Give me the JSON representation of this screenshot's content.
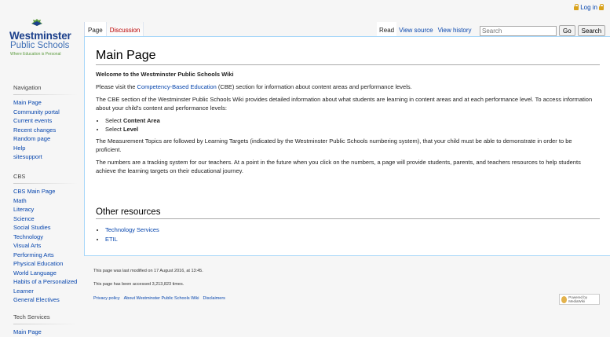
{
  "personal": {
    "login": "Log in"
  },
  "logo": {
    "line1": "Westminster",
    "line2": "Public Schools",
    "tagline": "Where Education is Personal"
  },
  "tabs": {
    "left": [
      "Page",
      "Discussion"
    ],
    "right": [
      "Read",
      "View source",
      "View history"
    ]
  },
  "search": {
    "placeholder": "Search",
    "go": "Go",
    "search": "Search"
  },
  "sidebar": {
    "navigation": {
      "heading": "Navigation",
      "items": [
        "Main Page",
        "Community portal",
        "Current events",
        "Recent changes",
        "Random page",
        "Help",
        "sitesupport"
      ]
    },
    "cbs": {
      "heading": "CBS",
      "items": [
        "CBS Main Page",
        "Math",
        "Literacy",
        "Science",
        "Social Studies",
        "Technology",
        "Visual Arts",
        "Performing Arts",
        "Physical Education",
        "World Language",
        "Habits of a Personalized Learner",
        "General Electives"
      ]
    },
    "tech": {
      "heading": "Tech Services",
      "items": [
        "Main Page"
      ]
    }
  },
  "content": {
    "title": "Main Page",
    "welcome": "Welcome to the Westminster Public Schools Wiki",
    "p1_before": "Please visit the ",
    "p1_link": "Competency-Based Education",
    "p1_after": " (CBE) section for information about content areas and performance levels.",
    "p2": "The CBE section of the Westminster Public Schools Wiki provides detailed information about what students are learning in content areas and at each performance level. To access information about your child's content and performance levels:",
    "bullets": [
      {
        "prefix": "Select ",
        "bold": "Content Area"
      },
      {
        "prefix": "Select ",
        "bold": "Level"
      }
    ],
    "p3": "The Measurement Topics are followed by Learning Targets (indicated by the Westminster Public Schools numbering system), that your child must be able to demonstrate in order to be proficient.",
    "p4": "The numbers are a tracking system for our teachers. At a point in the future when you click on the numbers, a page will provide students, parents, and teachers resources to help students achieve the learning targets on their educational journey.",
    "other_heading": "Other resources",
    "other_links": [
      "Technology Services",
      "ETIL"
    ]
  },
  "footer": {
    "modified": "This page was last modified on 17 August 2016, at 13:45.",
    "views": "This page has been accessed 3,213,823 times.",
    "links": [
      "Privacy policy",
      "About Westminster Public Schools Wiki",
      "Disclaimers"
    ],
    "powered": "Powered by MediaWiki"
  },
  "colors": {
    "link": "#0645ad",
    "redlink": "#ba0000",
    "border": "#a7d7f9"
  }
}
